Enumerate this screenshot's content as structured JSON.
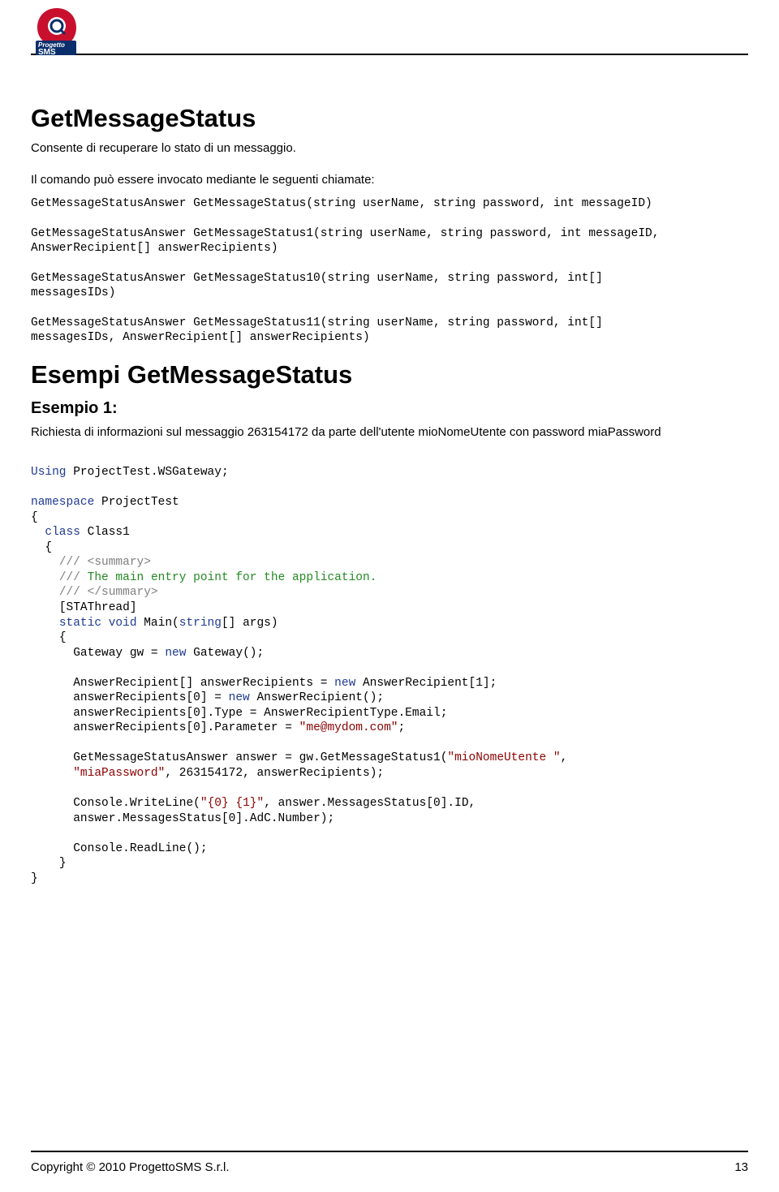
{
  "logo": {
    "top_text": "Progetto",
    "bottom_text": "SMS"
  },
  "section": {
    "title": "GetMessageStatus",
    "description": "Consente di recuperare lo stato di un messaggio.",
    "intro": "Il comando può essere invocato mediante le seguenti chiamate:",
    "signatures": [
      "GetMessageStatusAnswer GetMessageStatus(string userName, string password, int messageID)",
      "GetMessageStatusAnswer GetMessageStatus1(string userName, string password, int messageID,\nAnswerRecipient[] answerRecipients)",
      "GetMessageStatusAnswer GetMessageStatus10(string userName, string password, int[]\nmessagesIDs)",
      "GetMessageStatusAnswer GetMessageStatus11(string userName, string password, int[]\nmessagesIDs, AnswerRecipient[] answerRecipients)"
    ]
  },
  "examples": {
    "title": "Esempi GetMessageStatus",
    "items": [
      {
        "heading": "Esempio 1:",
        "description": "Richiesta di informazioni sul messaggio 263154172 da parte dell'utente mioNomeUtente con password miaPassword",
        "code": {
          "using_kw": "Using",
          "using_ns": " ProjectTest.WSGateway;",
          "ns_kw": "namespace",
          "ns_name": " ProjectTest",
          "ob": "{",
          "class_kw": "class",
          "class_name": " Class1",
          "class_ob": "  {",
          "doc1": "    /// <summary>",
          "doc2_prefix": "    /// ",
          "doc2_text": "The main entry point for the application.",
          "doc3": "    /// </summary>",
          "attr": "    [STAThread]",
          "main_sig_kw1": "static void",
          "main_name": " Main(",
          "main_param_kw": "string",
          "main_rest": "[] args)",
          "main_ob": "    {",
          "gw_decl": "Gateway gw = ",
          "new_kw": "new",
          "gw_ctor": " Gateway();",
          "ar_decl": "AnswerRecipient[] answerRecipients = ",
          "ar_ctor": " AnswerRecipient[1];",
          "ar0_decl": "answerRecipients[0] = ",
          "ar0_ctor": " AnswerRecipient();",
          "ar_type": "      answerRecipients[0].Type = AnswerRecipientType.Email;",
          "ar_param_pre": "      answerRecipients[0].Parameter = ",
          "ar_param_str": "\"me@mydom.com\"",
          "ar_param_post": ";",
          "ans_pre": "      GetMessageStatusAnswer answer = gw.GetMessageStatus1(",
          "ans_str1": "\"mioNomeUtente \"",
          "ans_mid1": ",\n      ",
          "ans_str2": "\"miaPassword\"",
          "ans_mid2": ", ",
          "ans_num": "263154172",
          "ans_post": ", answerRecipients);",
          "cw_pre": "      Console.WriteLine(",
          "cw_str": "\"{0} {1}\"",
          "cw_post": ", answer.MessagesStatus[0].ID,\n      answer.MessagesStatus[0].AdC.Number);",
          "rl": "      Console.ReadLine();",
          "main_cb": "    }",
          "class_cb": "}"
        }
      }
    ]
  },
  "footer": {
    "copyright": "Copyright © 2010 ProgettoSMS S.r.l.",
    "page_number": "13"
  }
}
